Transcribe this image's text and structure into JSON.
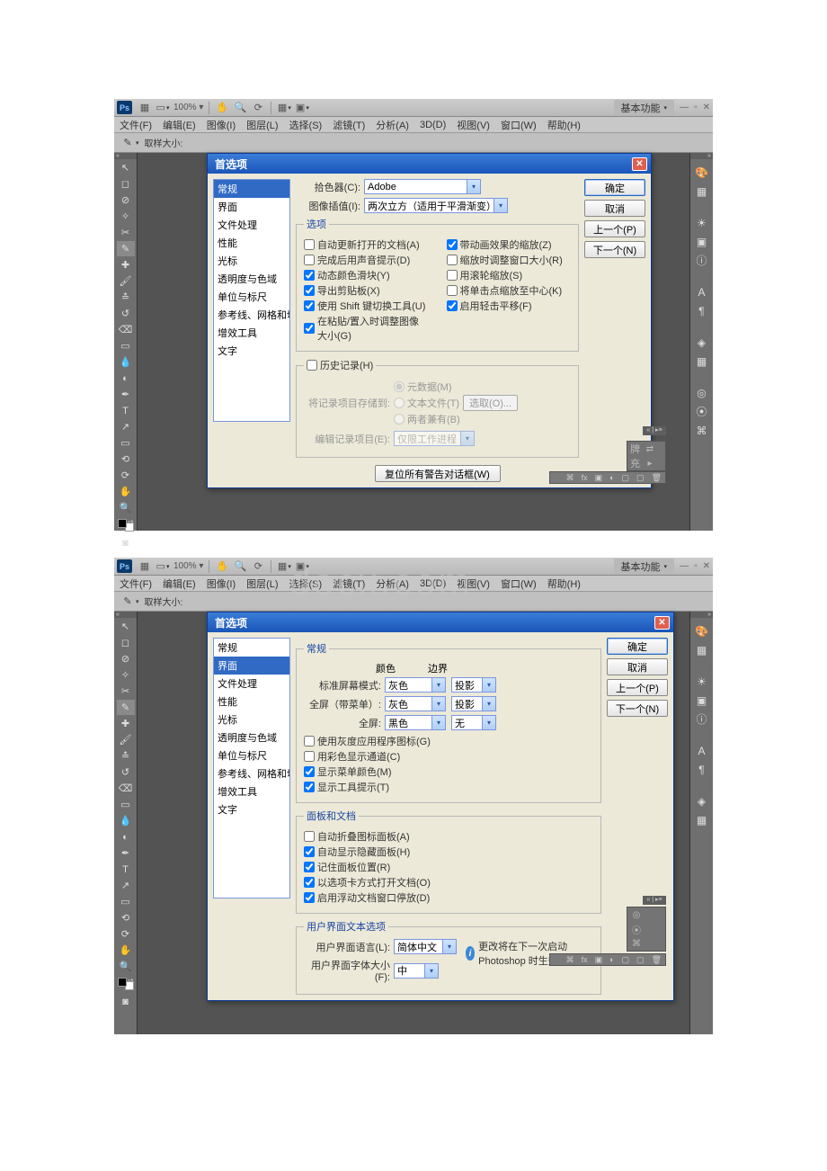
{
  "toprow": {
    "zoom": "100% ▾",
    "basic": "基本功能"
  },
  "menu": {
    "file": "文件(F)",
    "edit": "编辑(E)",
    "image": "图像(I)",
    "layer": "图层(L)",
    "select": "选择(S)",
    "filter": "滤镜(T)",
    "analyze": "分析(A)",
    "threeD": "3D(D)",
    "view": "视图(V)",
    "window": "窗口(W)",
    "help": "帮助(H)"
  },
  "optbar": {
    "sample": "取样大小:"
  },
  "dialog1": {
    "title": "首选项",
    "cats": [
      "常规",
      "界面",
      "文件处理",
      "性能",
      "光标",
      "透明度与色域",
      "单位与标尺",
      "参考线、网格和切片",
      "增效工具",
      "文字"
    ],
    "sel": 0,
    "picker_lbl": "拾色器(C):",
    "picker_val": "Adobe",
    "interp_lbl": "图像插值(I):",
    "interp_val": "两次立方（适用于平滑渐变）",
    "opts_legend": "选项",
    "left_checks": [
      {
        "label": "自动更新打开的文档(A)",
        "checked": false
      },
      {
        "label": "完成后用声音提示(D)",
        "checked": false
      },
      {
        "label": "动态颜色滑块(Y)",
        "checked": true
      },
      {
        "label": "导出剪贴板(X)",
        "checked": true
      },
      {
        "label": "使用 Shift 键切换工具(U)",
        "checked": true
      },
      {
        "label": "在粘贴/置入时调整图像大小(G)",
        "checked": true
      }
    ],
    "right_checks": [
      {
        "label": "带动画效果的缩放(Z)",
        "checked": true
      },
      {
        "label": "缩放时调整窗口大小(R)",
        "checked": false
      },
      {
        "label": "用滚轮缩放(S)",
        "checked": false
      },
      {
        "label": "将单击点缩放至中心(K)",
        "checked": false
      },
      {
        "label": "启用轻击平移(F)",
        "checked": true
      }
    ],
    "history_chk": "历史记录(H)",
    "history_lbl": "将记录项目存储到:",
    "history_radios": [
      "元数据(M)",
      "文本文件(T)",
      "两者兼有(B)"
    ],
    "history_pick": "选取(O)...",
    "editlog_lbl": "编辑记录项目(E):",
    "editlog_val": "仅限工作进程",
    "reset_btn": "复位所有警告对话框(W)",
    "buttons": {
      "ok": "确定",
      "cancel": "取消",
      "prev": "上一个(P)",
      "next": "下一个(N)"
    }
  },
  "dialog2": {
    "title": "首选项",
    "cats": [
      "常规",
      "界面",
      "文件处理",
      "性能",
      "光标",
      "透明度与色域",
      "单位与标尺",
      "参考线、网格和切片",
      "增效工具",
      "文字"
    ],
    "sel": 1,
    "general_legend": "常规",
    "col_head_color": "颜色",
    "col_head_border": "边界",
    "row1_lbl": "标准屏幕模式:",
    "row1_color": "灰色",
    "row1_border": "投影",
    "row2_lbl": "全屏（带菜单）:",
    "row2_color": "灰色",
    "row2_border": "投影",
    "row3_lbl": "全屏:",
    "row3_color": "黑色",
    "row3_border": "无",
    "gen_checks": [
      {
        "label": "使用灰度应用程序图标(G)",
        "checked": false
      },
      {
        "label": "用彩色显示通道(C)",
        "checked": false
      },
      {
        "label": "显示菜单颜色(M)",
        "checked": true
      },
      {
        "label": "显示工具提示(T)",
        "checked": true
      }
    ],
    "panels_legend": "面板和文档",
    "panel_checks": [
      {
        "label": "自动折叠图标面板(A)",
        "checked": false
      },
      {
        "label": "自动显示隐藏面板(H)",
        "checked": true
      },
      {
        "label": "记住面板位置(R)",
        "checked": true
      },
      {
        "label": "以选项卡方式打开文档(O)",
        "checked": true
      },
      {
        "label": "启用浮动文档窗口停放(D)",
        "checked": true
      }
    ],
    "uitext_legend": "用户界面文本选项",
    "lang_lbl": "用户界面语言(L):",
    "lang_val": "简体中文",
    "font_lbl": "用户界面字体大小(F):",
    "font_val": "中",
    "hint": "更改将在下一次启动 Photoshop 时生效。",
    "buttons": {
      "ok": "确定",
      "cancel": "取消",
      "prev": "上一个(P)",
      "next": "下一个(N)"
    }
  }
}
